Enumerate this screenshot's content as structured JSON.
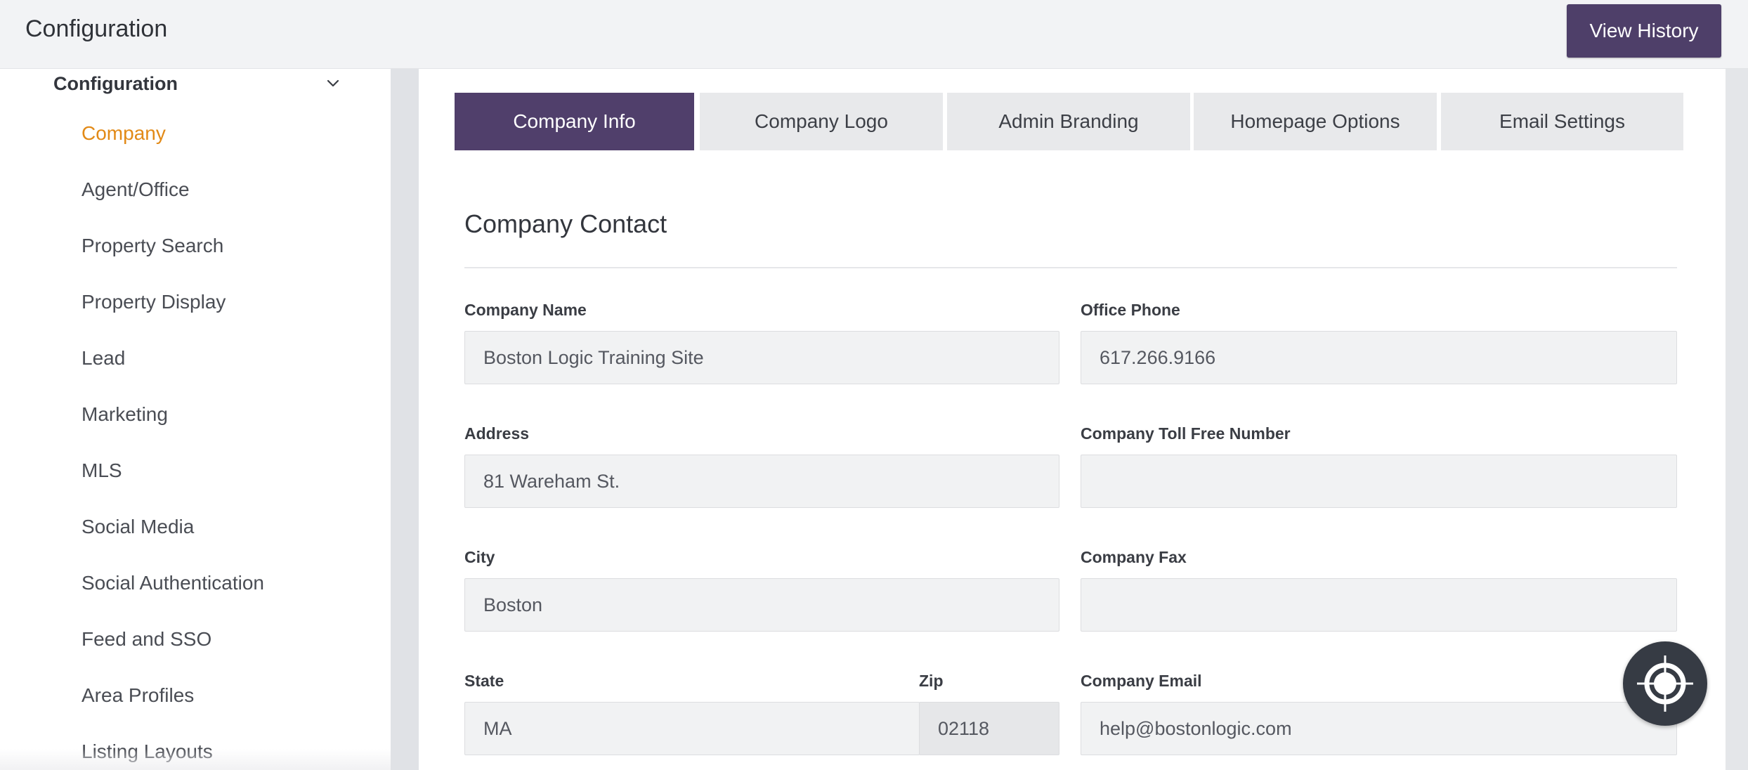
{
  "header": {
    "title": "Configuration",
    "view_history_label": "View History"
  },
  "sidebar": {
    "section_label": "Configuration",
    "items": [
      {
        "label": "Company",
        "active": true
      },
      {
        "label": "Agent/Office"
      },
      {
        "label": "Property Search"
      },
      {
        "label": "Property Display"
      },
      {
        "label": "Lead"
      },
      {
        "label": "Marketing"
      },
      {
        "label": "MLS"
      },
      {
        "label": "Social Media"
      },
      {
        "label": "Social Authentication"
      },
      {
        "label": "Feed and SSO"
      },
      {
        "label": "Area Profiles"
      },
      {
        "label": "Listing Layouts"
      }
    ]
  },
  "tabs": [
    {
      "label": "Company Info",
      "active": true
    },
    {
      "label": "Company Logo"
    },
    {
      "label": "Admin Branding"
    },
    {
      "label": "Homepage Options"
    },
    {
      "label": "Email Settings"
    }
  ],
  "form": {
    "section_title": "Company Contact",
    "company_name": {
      "label": "Company Name",
      "value": "Boston Logic Training Site"
    },
    "office_phone": {
      "label": "Office Phone",
      "value": "617.266.9166"
    },
    "address": {
      "label": "Address",
      "value": "81 Wareham St."
    },
    "toll_free": {
      "label": "Company Toll Free Number",
      "value": ""
    },
    "city": {
      "label": "City",
      "value": "Boston"
    },
    "fax": {
      "label": "Company Fax",
      "value": ""
    },
    "state": {
      "label": "State",
      "value": "MA"
    },
    "zip": {
      "label": "Zip",
      "value": "02118"
    },
    "email": {
      "label": "Company Email",
      "value": "help@bostonlogic.com"
    }
  },
  "colors": {
    "accent_purple": "#503f6b",
    "active_nav_orange": "#e28a17",
    "fab_dark": "#363b44"
  },
  "icons": {
    "section_toggle": "chevron-down-icon",
    "floating_button": "crosshair-icon"
  }
}
